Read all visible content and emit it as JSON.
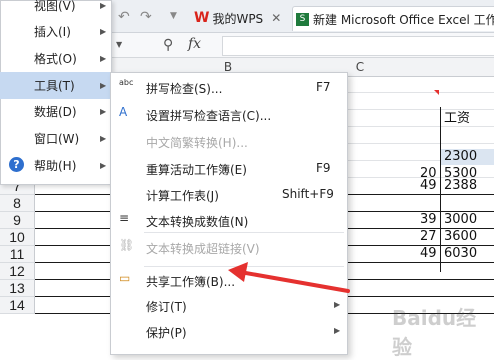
{
  "tabs": {
    "wps_label": "我的WPS",
    "excel_label": "新建 Microsoft Office Excel 工作"
  },
  "formula": {
    "fx_label": "fx"
  },
  "columns": [
    "B",
    "C"
  ],
  "rows": [
    {
      "num": "",
      "cells": []
    },
    {
      "num": "",
      "cells": []
    },
    {
      "num": "",
      "cells": []
    },
    {
      "num": "",
      "cells": []
    },
    {
      "num": "",
      "cells": []
    },
    {
      "num": "",
      "cells": []
    },
    {
      "num": "7",
      "c": "49",
      "d": "2388"
    },
    {
      "num": "8",
      "c": "",
      "d": ""
    },
    {
      "num": "9",
      "c": "39",
      "d": "3000"
    },
    {
      "num": "10",
      "c": "27",
      "d": "3600"
    },
    {
      "num": "11",
      "c": "49",
      "d": "6030"
    },
    {
      "num": "12",
      "c": "",
      "d": ""
    },
    {
      "num": "13",
      "c": "",
      "d": ""
    },
    {
      "num": "14",
      "c": "",
      "d": ""
    }
  ],
  "grid_extra": {
    "header_salary": "工资",
    "r5_d": "2300",
    "r6_c": "20",
    "r6_d": "5300"
  },
  "parent_menu": [
    {
      "label": "视图(V)",
      "arrow": "▶"
    },
    {
      "label": "插入(I)",
      "arrow": "▶"
    },
    {
      "label": "格式(O)",
      "arrow": "▶"
    },
    {
      "label": "工具(T)",
      "arrow": "▶"
    },
    {
      "label": "数据(D)",
      "arrow": "▶"
    },
    {
      "label": "窗口(W)",
      "arrow": "▶"
    },
    {
      "label": "帮助(H)",
      "arrow": "▶"
    }
  ],
  "submenu": [
    {
      "label": "拼写检查(S)...",
      "shortcut": "F7"
    },
    {
      "label": "设置拼写检查语言(C)...",
      "shortcut": ""
    },
    {
      "label": "中文简繁转换(H)...",
      "shortcut": ""
    },
    {
      "label": "重算活动工作簿(E)",
      "shortcut": "F9"
    },
    {
      "label": "计算工作表(J)",
      "shortcut": "Shift+F9"
    },
    {
      "label": "文本转换成数值(N)",
      "shortcut": ""
    },
    {
      "label": "文本转换成超链接(V)",
      "shortcut": ""
    },
    {
      "label": "共享工作簿(B)...",
      "shortcut": ""
    },
    {
      "label": "修订(T)",
      "shortcut": ""
    },
    {
      "label": "保护(P)",
      "shortcut": ""
    }
  ],
  "watermark": "Baidu经验",
  "colors": {
    "hover": "#c6d9f1",
    "arrow": "#e5312f",
    "wps_red": "#d9241b",
    "excel_green": "#1f7a3c",
    "help_blue": "#2e6fce"
  }
}
